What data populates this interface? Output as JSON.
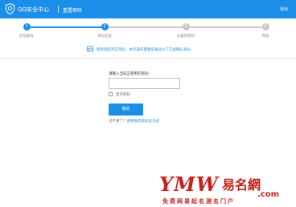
{
  "header": {
    "brand": "QQ安全中心",
    "page_title": "重置密码",
    "exit_label": "退出"
  },
  "steps": [
    {
      "number": "1",
      "label": "验证帐号",
      "state": "done"
    },
    {
      "number": "2",
      "label": "身份验证",
      "state": "active"
    },
    {
      "number": "3",
      "label": "设置新密码",
      "state": "pending"
    },
    {
      "number": "4",
      "label": "完成",
      "state": "pending"
    }
  ],
  "notice": {
    "text": "经检测您存在风险，本次操作需要您通过以下方式确认身份"
  },
  "form": {
    "label": "请输入当前正使用的密码：",
    "password_value": "",
    "show_password_label": "显示密码",
    "confirm_label": "确定",
    "forgot_prefix": "记不清了？",
    "forgot_link": "请更换其他验证方式"
  },
  "watermark": {
    "text": "YMW易名網",
    "domain": ".com",
    "tagline": "免费网易起名测名门户"
  },
  "colors": {
    "primary": "#1a8ee8",
    "pending": "#c8c8c8",
    "watermark_red": "#c8201c"
  }
}
